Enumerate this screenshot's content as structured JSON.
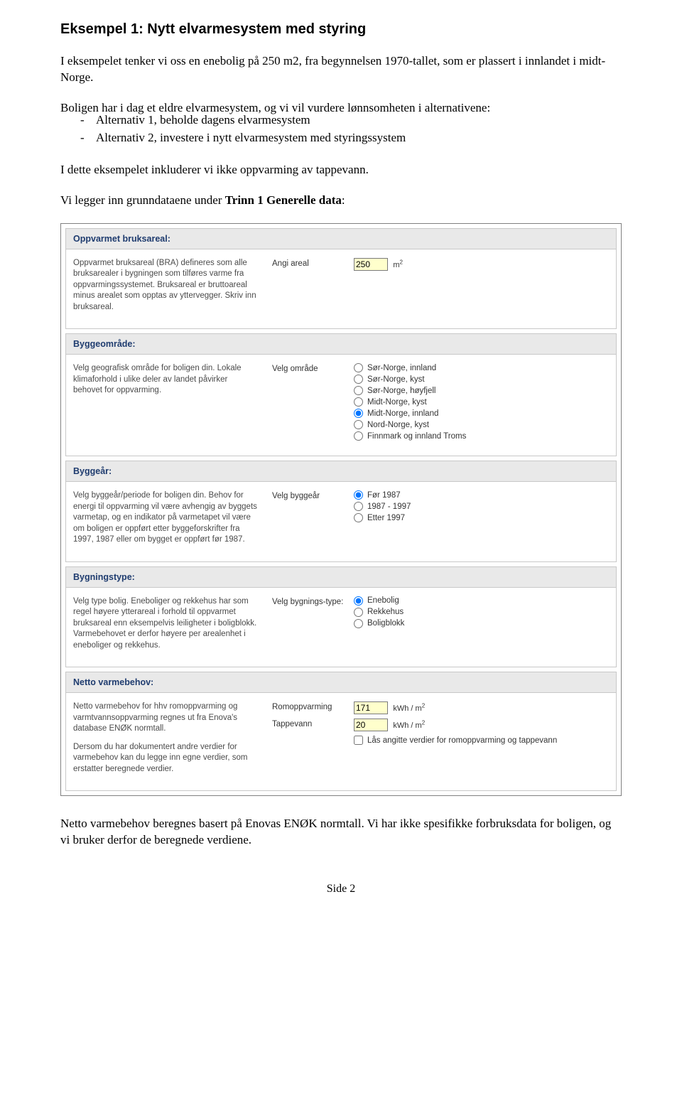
{
  "title": "Eksempel 1: Nytt elvarmesystem med styring",
  "intro": "I eksempelet tenker vi oss en enebolig på 250 m2, fra begynnelsen 1970-tallet, som er plassert i innlandet i midt-Norge.",
  "para2_lead": "Boligen har i dag et eldre elvarmesystem, og vi vil vurdere lønnsomheten i alternativene:",
  "alt1": "Alternativ 1, beholde dagens elvarmesystem",
  "alt2": "Alternativ 2, investere i nytt elvarmesystem med styringssystem",
  "para3": "I dette eksempelet inkluderer vi ikke oppvarming av tappevann.",
  "para4_pre": "Vi legger inn grunndataene under ",
  "para4_bold": "Trinn 1 Generelle data",
  "para4_post": ":",
  "sections": {
    "bruksareal": {
      "head": "Oppvarmet bruksareal:",
      "desc": "Oppvarmet bruksareal (BRA) defineres som alle bruksarealer i bygningen som tilføres varme fra oppvarmingssystemet. Bruksareal er bruttoareal minus arealet som opptas av yttervegger. Skriv inn bruksareal.",
      "label": "Angi areal",
      "value": "250",
      "unit_html": "m²"
    },
    "byggeomrade": {
      "head": "Byggeområde:",
      "desc": "Velg geografisk område for boligen din. Lokale klimaforhold i ulike deler av landet påvirker behovet for oppvarming.",
      "label": "Velg område",
      "options": [
        "Sør-Norge, innland",
        "Sør-Norge, kyst",
        "Sør-Norge, høyfjell",
        "Midt-Norge, kyst",
        "Midt-Norge, innland",
        "Nord-Norge, kyst",
        "Finnmark og innland Troms"
      ],
      "selected": 4
    },
    "byggeaar": {
      "head": "Byggeår:",
      "desc": "Velg byggeår/periode for boligen din. Behov for energi til oppvarming vil være avhengig av byggets varmetap, og en indikator på varmetapet vil være om boligen er oppført etter byggeforskrifter fra 1997, 1987 eller om bygget er oppført før 1987.",
      "label": "Velg byggeår",
      "options": [
        "Før 1987",
        "1987 - 1997",
        "Etter 1997"
      ],
      "selected": 0
    },
    "bygningstype": {
      "head": "Bygningstype:",
      "desc": "Velg type bolig. Eneboliger og rekkehus har som regel høyere ytterareal i forhold til oppvarmet bruksareal enn eksempelvis leiligheter i boligblokk. Varmebehovet er derfor høyere per arealenhet i eneboliger og rekkehus.",
      "label": "Velg bygnings-type:",
      "options": [
        "Enebolig",
        "Rekkehus",
        "Boligblokk"
      ],
      "selected": 0
    },
    "varmebehov": {
      "head": "Netto varmebehov:",
      "desc1": "Netto varmebehov for hhv romoppvarming og varmtvannsoppvarming regnes ut fra Enova's database ENØK normtall.",
      "desc2": "Dersom du har dokumentert andre verdier for varmebehov kan du legge inn egne verdier, som erstatter beregnede verdier.",
      "label1": "Romoppvarming",
      "value1": "171",
      "label2": "Tappevann",
      "value2": "20",
      "unit": "kWh / m²",
      "lock": "Lås angitte verdier for romoppvarming og tappevann"
    }
  },
  "below": "Netto varmebehov beregnes basert på Enovas ENØK normtall. Vi har ikke spesifikke forbruksdata for boligen, og vi bruker derfor de beregnede verdiene.",
  "footer": "Side 2"
}
